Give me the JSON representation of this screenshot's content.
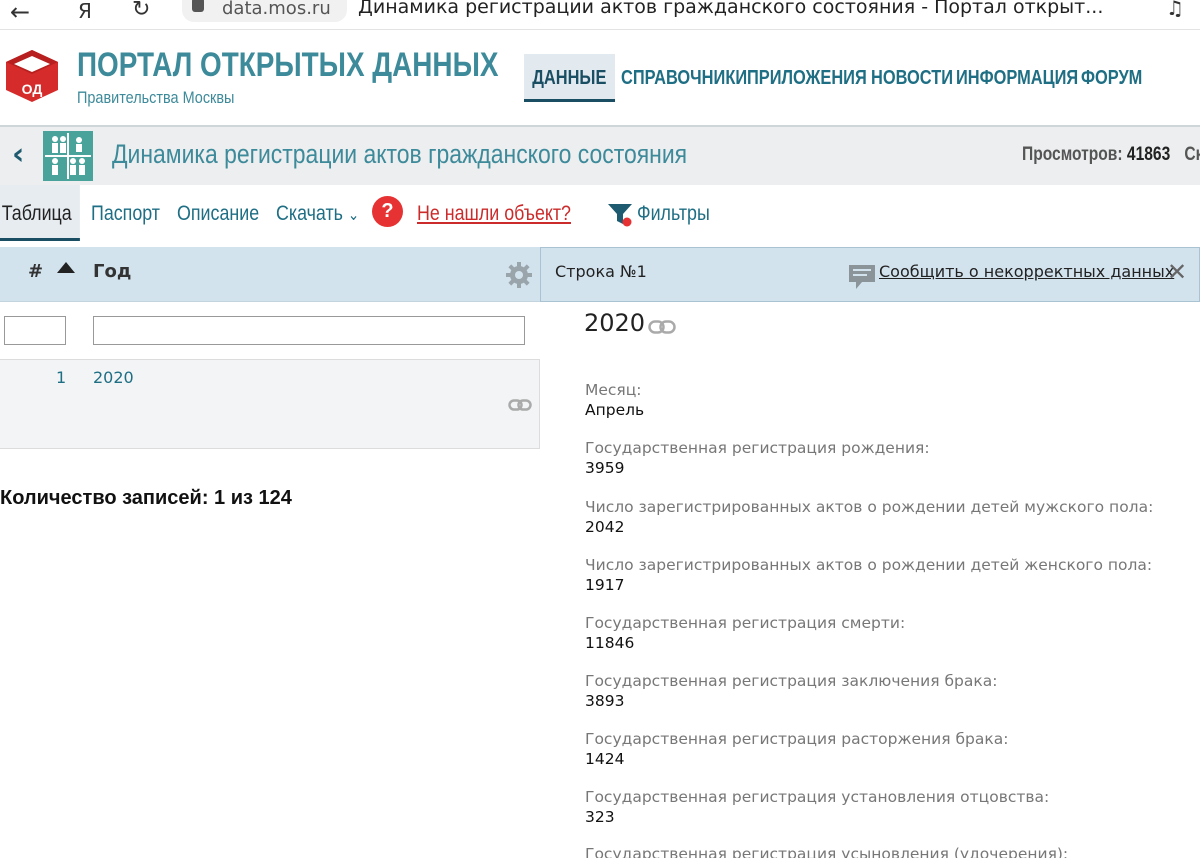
{
  "browser": {
    "back_glyph": "←",
    "yandex_glyph": "Я",
    "reload_glyph": "↻",
    "url": "data.mos.ru",
    "tab_title": "Динамика регистрации актов гражданского состояния - Портал открыт..."
  },
  "portal": {
    "logo_text": "ОД",
    "name": "ПОРТАЛ ОТКРЫТЫХ ДАННЫХ",
    "subtitle": "Правительства Москвы",
    "nav": [
      {
        "label": "ДАННЫЕ",
        "active": true
      },
      {
        "label": "СПРАВОЧНИКИ"
      },
      {
        "label": "ПРИЛОЖЕНИЯ"
      },
      {
        "label": "НОВОСТИ"
      },
      {
        "label": "ИНФОРМАЦИЯ"
      },
      {
        "label": "ФОРУМ"
      }
    ]
  },
  "dataset": {
    "title": "Динамика регистрации актов гражданского состояния",
    "views_label": "Просмотров:",
    "views_count": "41863",
    "views_trailing": "Ска"
  },
  "tabs": {
    "table": "Таблица",
    "passport": "Паспорт",
    "description": "Описание",
    "download": "Скачать",
    "download_chevron": "⌄",
    "help": "?",
    "not_found": "Не нашли объект?",
    "filters": "Фильтры"
  },
  "table": {
    "col_num": "#",
    "col_year": "Год",
    "rows": [
      {
        "num": "1",
        "year": "2020"
      }
    ],
    "record_count": "Количество записей: 1 из 124"
  },
  "detail": {
    "row_label": "Строка №1",
    "report_link": "Сообщить о некорректных данных",
    "close": "✕",
    "year": "2020",
    "fields": [
      {
        "label": "Месяц:",
        "value": "Апрель"
      },
      {
        "label": "Государственная регистрация рождения:",
        "value": "3959"
      },
      {
        "label": "Число зарегистрированных актов о рождении детей мужского пола:",
        "value": "2042"
      },
      {
        "label": "Число зарегистрированных актов о рождении детей женского пола:",
        "value": "1917"
      },
      {
        "label": "Государственная регистрация смерти:",
        "value": "11846"
      },
      {
        "label": "Государственная регистрация заключения брака:",
        "value": "3893"
      },
      {
        "label": "Государственная регистрация расторжения брака:",
        "value": "1424"
      },
      {
        "label": "Государственная регистрация установления отцовства:",
        "value": "323"
      },
      {
        "label": "Государственная регистрация усыновления (удочерения):",
        "value": ""
      }
    ]
  },
  "colors": {
    "brand_teal": "#3d8a9a",
    "nav_blue": "#1e6e84",
    "header_bg": "#d3e3ee",
    "alert_red": "#e63232",
    "logo_red": "#d62b2b"
  }
}
